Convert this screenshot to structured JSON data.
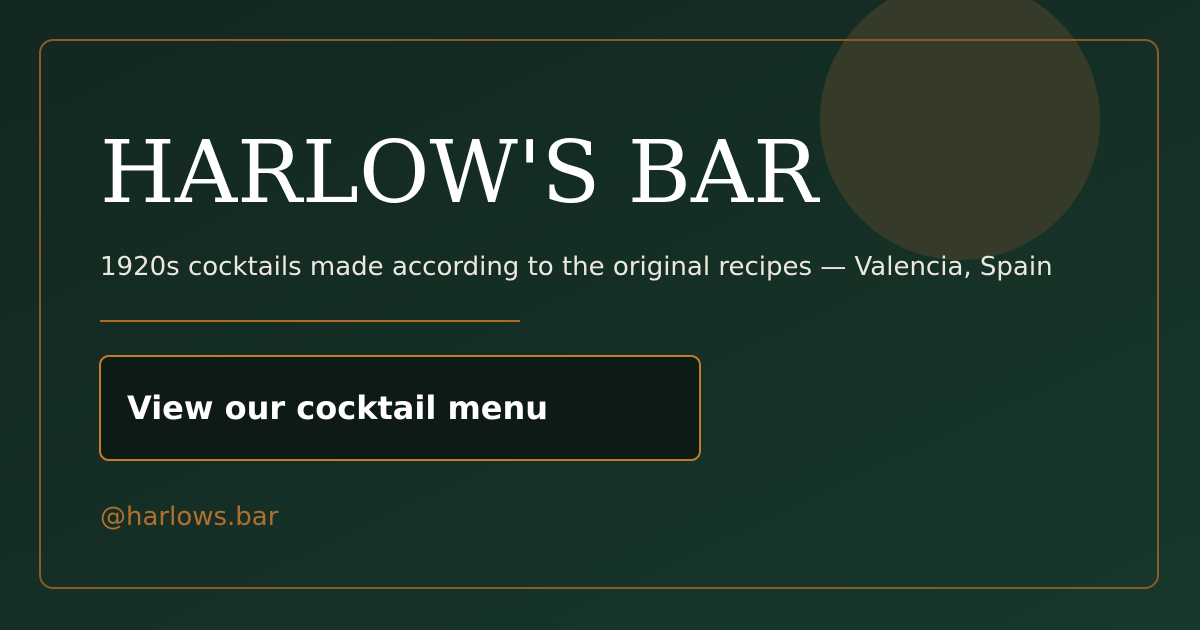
{
  "brand": {
    "name": "HARLOW'S BAR",
    "tagline": "1920s cocktails made according to the original recipes — Valencia, Spain",
    "handle": "@harlows.bar"
  },
  "cta": {
    "label": "View our cocktail menu"
  },
  "colors": {
    "background": "#152e25",
    "accent": "#b06a26",
    "circle": "#363b29",
    "button_bg": "#0e1a15",
    "text": "#ffffff"
  }
}
